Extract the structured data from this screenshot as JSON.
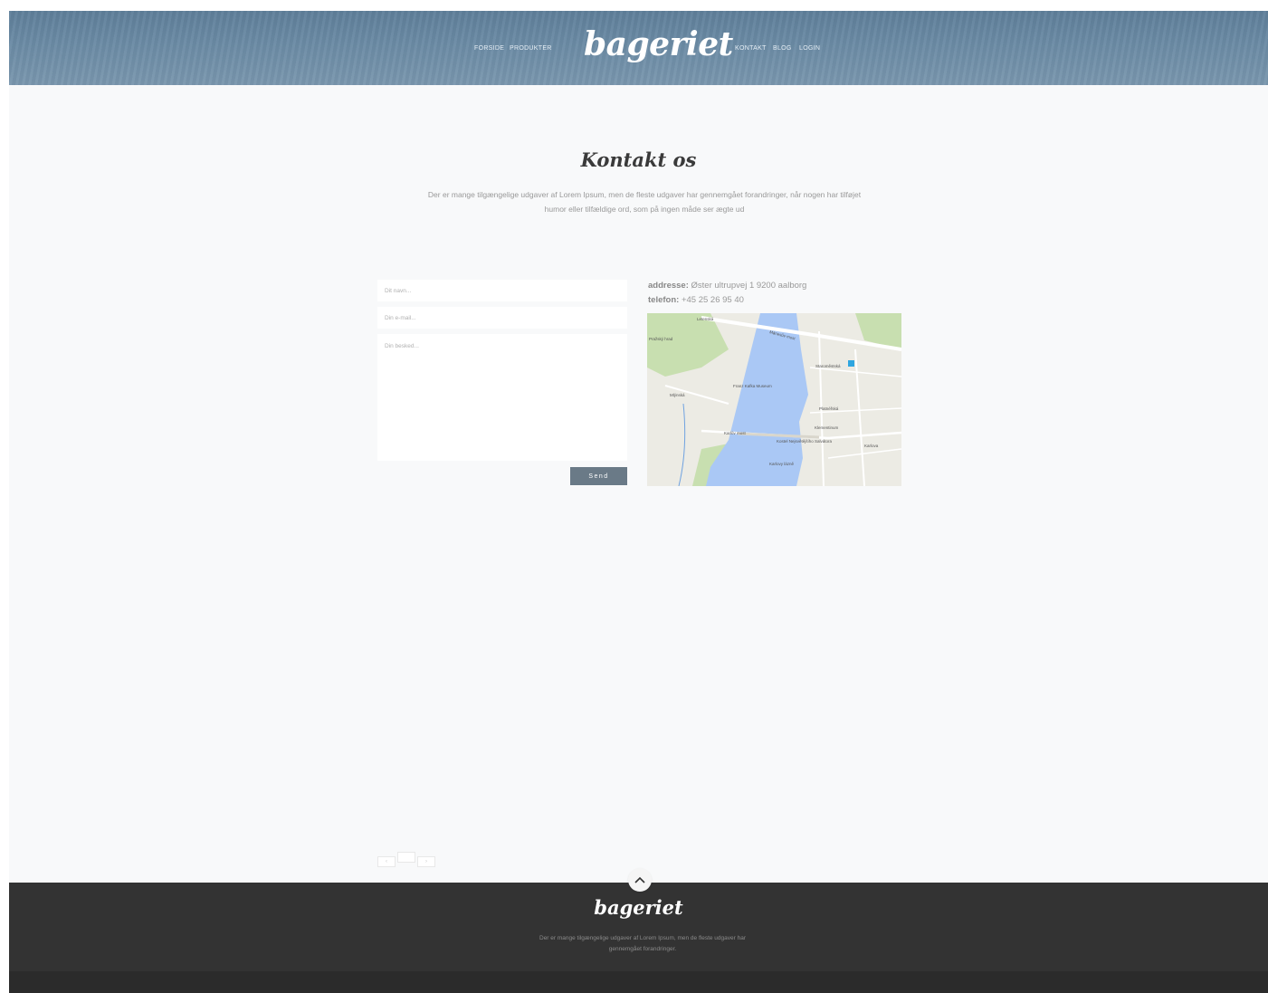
{
  "header": {
    "logo": "bageriet",
    "nav_left": [
      "FORSIDE",
      "PRODUKTER"
    ],
    "nav_right": [
      "KONTAKT",
      "BLOG",
      "LOGIN"
    ]
  },
  "intro": {
    "title": "Kontakt os",
    "text": "Der er mange tilgængelige udgaver af Lorem Ipsum, men de fleste udgaver har gennemgået forandringer, når nogen har tilføjet humor eller tilfældige ord, som på ingen måde ser ægte ud"
  },
  "form": {
    "name_placeholder": "Dit navn...",
    "email_placeholder": "Din e-mail...",
    "message_placeholder": "Din besked...",
    "send_label": "Send"
  },
  "contact": {
    "address_label": "addresse:",
    "address_value": " Øster ultrupvej 1 9200 aalborg",
    "phone_label": "telefon:",
    "phone_value": " +45 25 26 95 40"
  },
  "map": {
    "labels": [
      "Letenská",
      "Mánesův most",
      "Franz Kafka Museum",
      "Staroměstská",
      "Platnéřská",
      "Karlův most",
      "Kostel Nejsvětějšího Salvátora",
      "Karlovy lázně",
      "Mlýnská",
      "Klementinum",
      "Karlova",
      "Pražský hrad"
    ],
    "water_color": "#aac8f5",
    "park_color": "#c8dfb0"
  },
  "pager": [
    "‹",
    "",
    "›"
  ],
  "footer": {
    "logo": "bageriet",
    "text": "Der er mange tilgængelige udgaver af Lorem Ipsum, men de fleste udgaver har gennemgået forandringer.",
    "scroll_top_icon": "chevron-up-icon"
  }
}
